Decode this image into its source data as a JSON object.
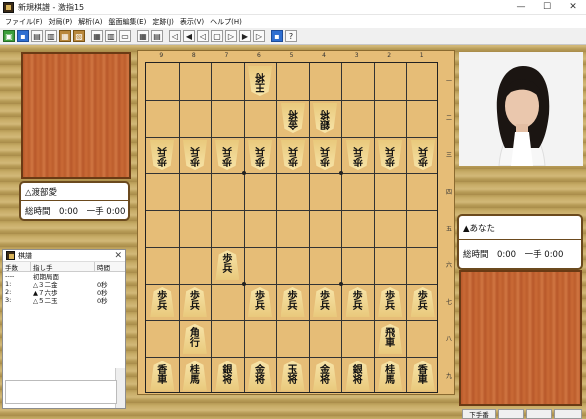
{
  "window": {
    "title": "新規棋譜 - 激指15",
    "minimize": "—",
    "maximize": "☐",
    "close": "✕"
  },
  "menu": [
    "ファイル(F)",
    "対局(P)",
    "解析(A)",
    "盤面編集(E)",
    "定跡(J)",
    "表示(V)",
    "ヘルプ(H)"
  ],
  "toolbar_icons": [
    "open-icon",
    "save-icon",
    "print-icon",
    "export-icon",
    "analysis-icon",
    "book-icon",
    "board-icon",
    "flip-icon",
    "page-icon",
    "edit-icon",
    "jump-first-icon",
    "step-back-10-icon",
    "step-back-icon",
    "stop-icon",
    "step-forward-icon",
    "step-forward-10-icon",
    "jump-last-icon",
    "display-icon",
    "help-icon"
  ],
  "players": {
    "gote": {
      "name": "△渡部愛",
      "time": "総時間　0:00　一手 0:00"
    },
    "sente": {
      "name": "▲あなた",
      "time": "総時間　0:00　一手 0:00"
    }
  },
  "board": {
    "files": [
      "9",
      "8",
      "7",
      "6",
      "5",
      "4",
      "3",
      "2",
      "1"
    ],
    "ranks": [
      "一",
      "二",
      "三",
      "四",
      "五",
      "六",
      "七",
      "八",
      "九"
    ],
    "pieces": [
      {
        "file": 6,
        "rank": 1,
        "text": "王将",
        "side": "gote"
      },
      {
        "file": 5,
        "rank": 2,
        "text": "金将",
        "side": "gote"
      },
      {
        "file": 4,
        "rank": 2,
        "text": "銀将",
        "side": "gote"
      },
      {
        "file": 9,
        "rank": 3,
        "text": "歩兵",
        "side": "gote"
      },
      {
        "file": 8,
        "rank": 3,
        "text": "歩兵",
        "side": "gote"
      },
      {
        "file": 7,
        "rank": 3,
        "text": "歩兵",
        "side": "gote"
      },
      {
        "file": 6,
        "rank": 3,
        "text": "歩兵",
        "side": "gote"
      },
      {
        "file": 5,
        "rank": 3,
        "text": "歩兵",
        "side": "gote"
      },
      {
        "file": 4,
        "rank": 3,
        "text": "歩兵",
        "side": "gote"
      },
      {
        "file": 3,
        "rank": 3,
        "text": "歩兵",
        "side": "gote"
      },
      {
        "file": 2,
        "rank": 3,
        "text": "歩兵",
        "side": "gote"
      },
      {
        "file": 1,
        "rank": 3,
        "text": "歩兵",
        "side": "gote"
      },
      {
        "file": 7,
        "rank": 6,
        "text": "歩兵",
        "side": "sente"
      },
      {
        "file": 9,
        "rank": 7,
        "text": "歩兵",
        "side": "sente"
      },
      {
        "file": 8,
        "rank": 7,
        "text": "歩兵",
        "side": "sente"
      },
      {
        "file": 6,
        "rank": 7,
        "text": "歩兵",
        "side": "sente"
      },
      {
        "file": 5,
        "rank": 7,
        "text": "歩兵",
        "side": "sente"
      },
      {
        "file": 4,
        "rank": 7,
        "text": "歩兵",
        "side": "sente"
      },
      {
        "file": 3,
        "rank": 7,
        "text": "歩兵",
        "side": "sente"
      },
      {
        "file": 2,
        "rank": 7,
        "text": "歩兵",
        "side": "sente"
      },
      {
        "file": 1,
        "rank": 7,
        "text": "歩兵",
        "side": "sente"
      },
      {
        "file": 8,
        "rank": 8,
        "text": "角行",
        "side": "sente"
      },
      {
        "file": 2,
        "rank": 8,
        "text": "飛車",
        "side": "sente"
      },
      {
        "file": 9,
        "rank": 9,
        "text": "香車",
        "side": "sente"
      },
      {
        "file": 8,
        "rank": 9,
        "text": "桂馬",
        "side": "sente"
      },
      {
        "file": 7,
        "rank": 9,
        "text": "銀将",
        "side": "sente"
      },
      {
        "file": 6,
        "rank": 9,
        "text": "金将",
        "side": "sente"
      },
      {
        "file": 5,
        "rank": 9,
        "text": "玉将",
        "side": "sente"
      },
      {
        "file": 4,
        "rank": 9,
        "text": "金将",
        "side": "sente"
      },
      {
        "file": 3,
        "rank": 9,
        "text": "銀将",
        "side": "sente"
      },
      {
        "file": 2,
        "rank": 9,
        "text": "桂馬",
        "side": "sente"
      },
      {
        "file": 1,
        "rank": 9,
        "text": "香車",
        "side": "sente"
      }
    ]
  },
  "kifu": {
    "title": "棋譜",
    "headers": [
      "手数",
      "指し手",
      "時間"
    ],
    "rows": [
      {
        "num": "----",
        "move": "初期局面",
        "time": ""
      },
      {
        "num": "1:",
        "move": "△３二金",
        "time": "0秒"
      },
      {
        "num": "2:",
        "move": "▲７六歩",
        "time": "0秒"
      },
      {
        "num": "3:",
        "move": "△５二玉",
        "time": "0秒"
      }
    ]
  },
  "bottom_buttons": [
    "下手番",
    "",
    "",
    ""
  ]
}
